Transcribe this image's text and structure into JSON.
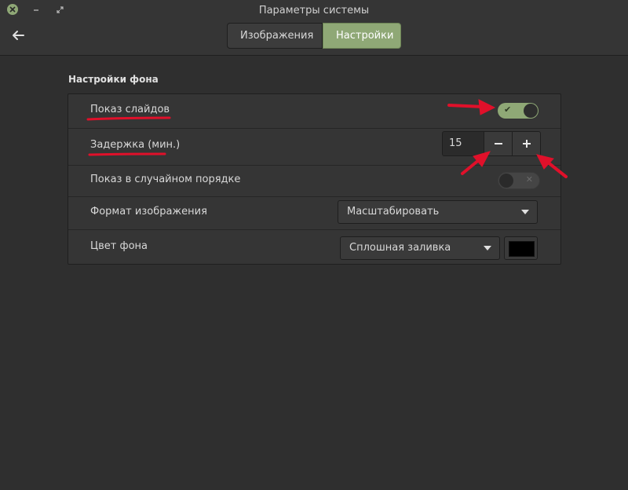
{
  "window": {
    "title": "Параметры системы",
    "close_icon": "close-icon",
    "minimize_icon": "minimize-icon",
    "maximize_icon": "maximize-icon"
  },
  "toolbar": {
    "back_icon": "back-arrow-icon",
    "tabs": [
      {
        "label": "Изображения",
        "active": false
      },
      {
        "label": "Настройки",
        "active": true
      }
    ]
  },
  "section": {
    "title": "Настройки фона",
    "rows": [
      {
        "label": "Показ слайдов",
        "control": "switch",
        "state": "on"
      },
      {
        "label": "Задержка (мин.)",
        "control": "spinbutton",
        "value": "15",
        "minus": "−",
        "plus": "+"
      },
      {
        "label": "Показ в случайном порядке",
        "control": "switch",
        "state": "off"
      },
      {
        "label": "Формат изображения",
        "control": "dropdown",
        "selected": "Масштабировать"
      },
      {
        "label": "Цвет фона",
        "control": "dropdown+color",
        "selected": "Сплошная заливка",
        "color": "#000000"
      }
    ]
  },
  "colors": {
    "accent": "#8fa876",
    "background": "#2f2f2f",
    "annotation": "#e0102a"
  }
}
